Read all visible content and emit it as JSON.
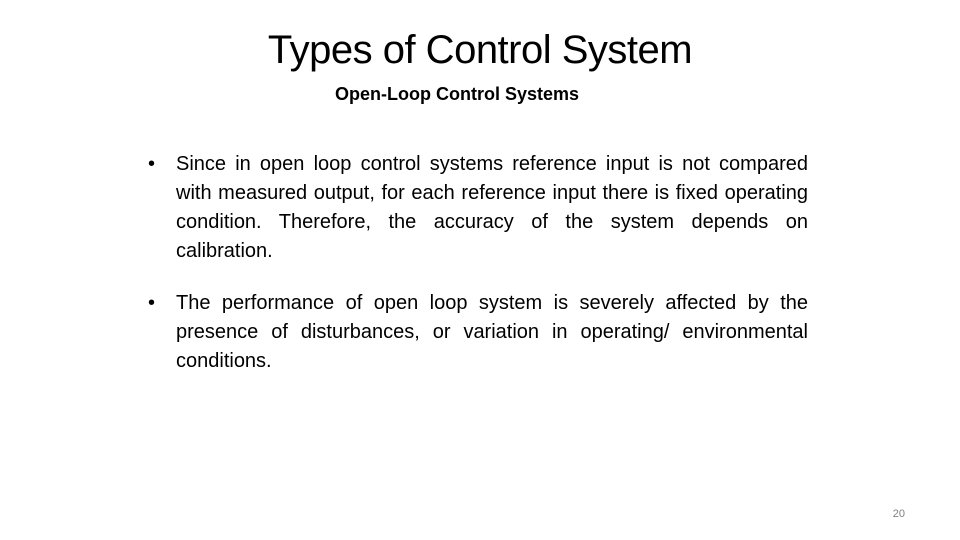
{
  "slide": {
    "title": "Types of Control System",
    "subtitle": "Open-Loop Control Systems",
    "bullets": [
      {
        "marker": "•",
        "text": "Since in open loop control systems reference input is not compared with measured output, for each reference input there is fixed operating condition. Therefore, the accuracy of the system depends on calibration."
      },
      {
        "marker": "•",
        "text": "The performance of open loop system is severely affected by the presence of disturbances, or variation in operating/ environmental conditions."
      }
    ],
    "page_number": "20"
  }
}
